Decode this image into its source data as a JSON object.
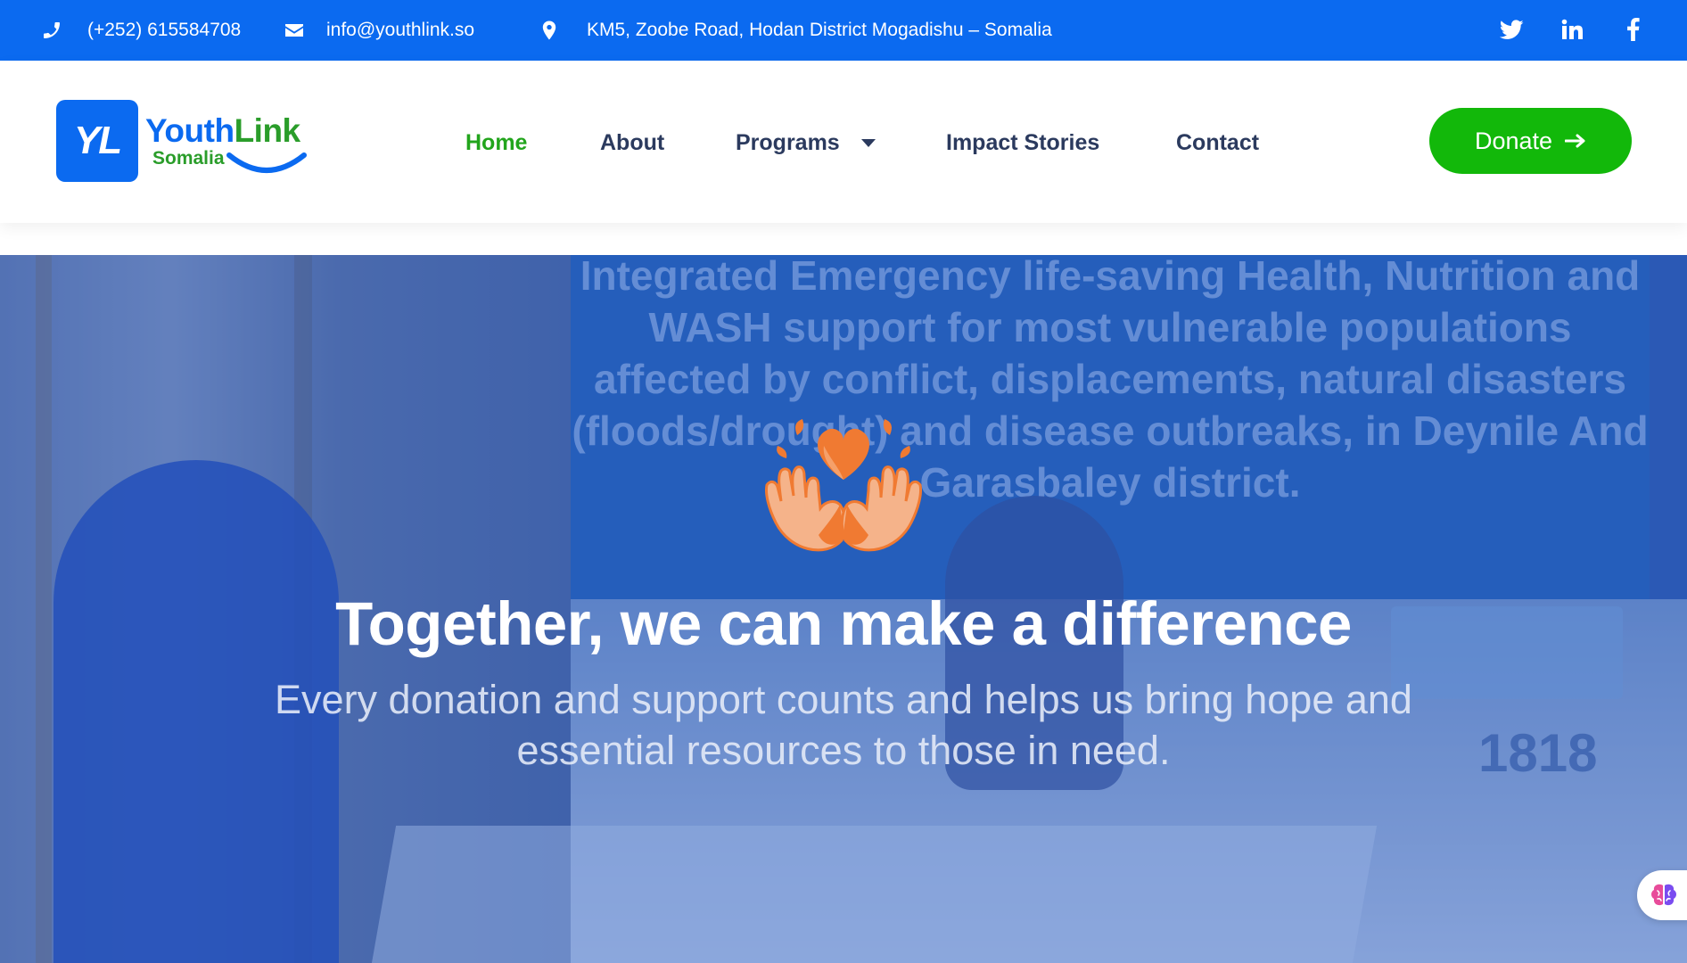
{
  "topbar": {
    "phone": "(+252) 615584708",
    "email": "info@youthlink.so",
    "address": "KM5, Zoobe Road, Hodan District Mogadishu – Somalia",
    "social": [
      "twitter-icon",
      "linkedin-icon",
      "facebook-icon"
    ]
  },
  "logo": {
    "mark": "YL",
    "word_youth": "Youth",
    "word_link": "Link",
    "subtitle": "Somalia"
  },
  "nav": {
    "items": [
      {
        "label": "Home",
        "active": true
      },
      {
        "label": "About"
      },
      {
        "label": "Programs",
        "has_dropdown": true
      },
      {
        "label": "Impact Stories"
      },
      {
        "label": "Contact"
      }
    ],
    "donate_label": "Donate"
  },
  "hero": {
    "background_sign_text": "Integrated Emergency life-saving Health, Nutrition and WASH support for most vulnerable populations affected by conflict, displacements, natural disasters (floods/drought) and disease outbreaks, in Deynile And Garasbaley district.",
    "hotline_number": "1818",
    "title": "Together, we can make a difference",
    "subtitle": "Every donation and support counts and helps us bring hope and essential resources to those in need."
  },
  "colors": {
    "topbar": "#0b6af0",
    "active_nav": "#22a51c",
    "donate": "#12b80a",
    "nav_text": "#2b3a5e",
    "hero_overlay": "#1950c8",
    "icon_orange": "#f07a32"
  }
}
